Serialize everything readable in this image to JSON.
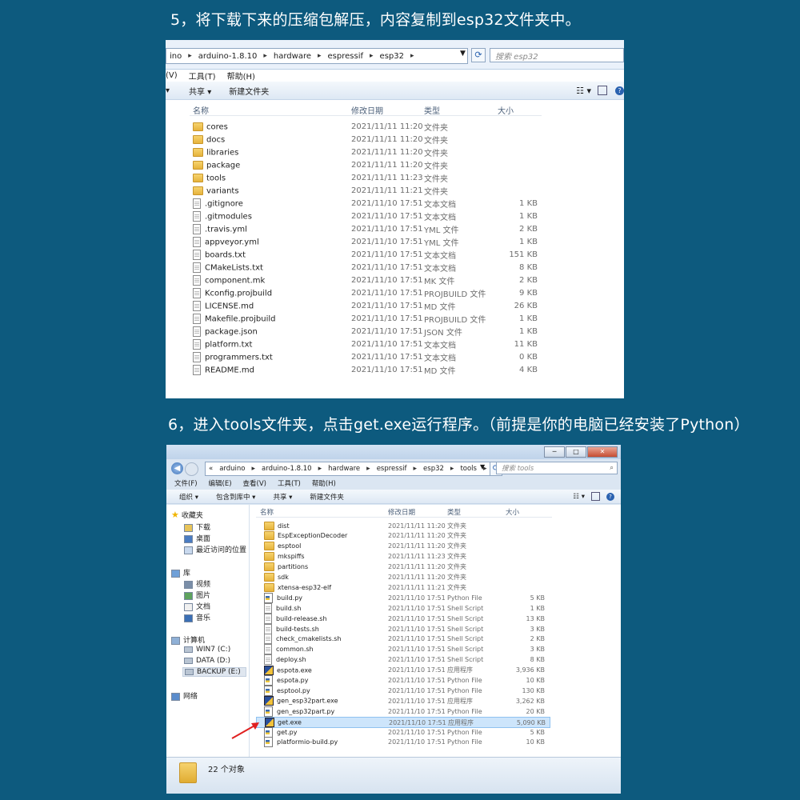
{
  "step5": {
    "heading": "5，将下载下来的压缩包解压，内容复制到esp32文件夹中。",
    "breadcrumb": [
      "ino",
      "arduino-1.8.10",
      "hardware",
      "espressif",
      "esp32"
    ],
    "search_placeholder": "搜索 esp32",
    "menus": [
      "(V)",
      "工具(T)",
      "帮助(H)"
    ],
    "toolbar": [
      "共享 ▾",
      "新建文件夹"
    ],
    "columns": [
      "名称",
      "修改日期",
      "类型",
      "大小"
    ],
    "files": [
      {
        "name": "cores",
        "date": "2021/11/11 11:20",
        "type": "文件夹",
        "size": "",
        "icon": "folder"
      },
      {
        "name": "docs",
        "date": "2021/11/11 11:20",
        "type": "文件夹",
        "size": "",
        "icon": "folder"
      },
      {
        "name": "libraries",
        "date": "2021/11/11 11:20",
        "type": "文件夹",
        "size": "",
        "icon": "folder"
      },
      {
        "name": "package",
        "date": "2021/11/11 11:20",
        "type": "文件夹",
        "size": "",
        "icon": "folder"
      },
      {
        "name": "tools",
        "date": "2021/11/11 11:23",
        "type": "文件夹",
        "size": "",
        "icon": "folder"
      },
      {
        "name": "variants",
        "date": "2021/11/11 11:21",
        "type": "文件夹",
        "size": "",
        "icon": "folder"
      },
      {
        "name": ".gitignore",
        "date": "2021/11/10 17:51",
        "type": "文本文档",
        "size": "1 KB",
        "icon": "file"
      },
      {
        "name": ".gitmodules",
        "date": "2021/11/10 17:51",
        "type": "文本文档",
        "size": "1 KB",
        "icon": "file"
      },
      {
        "name": ".travis.yml",
        "date": "2021/11/10 17:51",
        "type": "YML 文件",
        "size": "2 KB",
        "icon": "file"
      },
      {
        "name": "appveyor.yml",
        "date": "2021/11/10 17:51",
        "type": "YML 文件",
        "size": "1 KB",
        "icon": "file"
      },
      {
        "name": "boards.txt",
        "date": "2021/11/10 17:51",
        "type": "文本文档",
        "size": "151 KB",
        "icon": "file"
      },
      {
        "name": "CMakeLists.txt",
        "date": "2021/11/10 17:51",
        "type": "文本文档",
        "size": "8 KB",
        "icon": "file"
      },
      {
        "name": "component.mk",
        "date": "2021/11/10 17:51",
        "type": "MK 文件",
        "size": "2 KB",
        "icon": "file"
      },
      {
        "name": "Kconfig.projbuild",
        "date": "2021/11/10 17:51",
        "type": "PROJBUILD 文件",
        "size": "9 KB",
        "icon": "file"
      },
      {
        "name": "LICENSE.md",
        "date": "2021/11/10 17:51",
        "type": "MD 文件",
        "size": "26 KB",
        "icon": "file"
      },
      {
        "name": "Makefile.projbuild",
        "date": "2021/11/10 17:51",
        "type": "PROJBUILD 文件",
        "size": "1 KB",
        "icon": "file"
      },
      {
        "name": "package.json",
        "date": "2021/11/10 17:51",
        "type": "JSON 文件",
        "size": "1 KB",
        "icon": "file"
      },
      {
        "name": "platform.txt",
        "date": "2021/11/10 17:51",
        "type": "文本文档",
        "size": "11 KB",
        "icon": "file"
      },
      {
        "name": "programmers.txt",
        "date": "2021/11/10 17:51",
        "type": "文本文档",
        "size": "0 KB",
        "icon": "file"
      },
      {
        "name": "README.md",
        "date": "2021/11/10 17:51",
        "type": "MD 文件",
        "size": "4 KB",
        "icon": "file"
      }
    ]
  },
  "step6": {
    "heading": "6，进入tools文件夹，点击get.exe运行程序。（前提是你的电脑已经安装了Python）",
    "breadcrumb": [
      "«",
      "arduino",
      "arduino-1.8.10",
      "hardware",
      "espressif",
      "esp32",
      "tools"
    ],
    "search_placeholder": "搜索 tools",
    "menus": [
      "文件(F)",
      "编辑(E)",
      "查看(V)",
      "工具(T)",
      "帮助(H)"
    ],
    "toolbar": [
      "组织 ▾",
      "包含到库中 ▾",
      "共享 ▾",
      "新建文件夹"
    ],
    "columns": [
      "名称",
      "修改日期",
      "类型",
      "大小"
    ],
    "nav": [
      {
        "label": "收藏夹",
        "icon": "star-icon"
      },
      {
        "label": "下载",
        "icon": "download-folder-icon"
      },
      {
        "label": "桌面",
        "icon": "desktop-icon"
      },
      {
        "label": "最近访问的位置",
        "icon": "recent-places-icon"
      },
      {
        "label": "库",
        "icon": "library-icon"
      },
      {
        "label": "视频",
        "icon": "video-icon"
      },
      {
        "label": "图片",
        "icon": "picture-icon"
      },
      {
        "label": "文档",
        "icon": "document-icon"
      },
      {
        "label": "音乐",
        "icon": "music-icon"
      },
      {
        "label": "计算机",
        "icon": "computer-icon"
      },
      {
        "label": "WIN7 (C:)",
        "icon": "drive-icon"
      },
      {
        "label": "DATA (D:)",
        "icon": "drive-icon"
      },
      {
        "label": "BACKUP (E:)",
        "icon": "drive-icon"
      },
      {
        "label": "网络",
        "icon": "network-icon"
      }
    ],
    "files": [
      {
        "name": "dist",
        "date": "2021/11/11 11:20",
        "type": "文件夹",
        "size": "",
        "icon": "folder"
      },
      {
        "name": "EspExceptionDecoder",
        "date": "2021/11/11 11:20",
        "type": "文件夹",
        "size": "",
        "icon": "folder"
      },
      {
        "name": "esptool",
        "date": "2021/11/11 11:20",
        "type": "文件夹",
        "size": "",
        "icon": "folder"
      },
      {
        "name": "mkspiffs",
        "date": "2021/11/11 11:23",
        "type": "文件夹",
        "size": "",
        "icon": "folder"
      },
      {
        "name": "partitions",
        "date": "2021/11/11 11:20",
        "type": "文件夹",
        "size": "",
        "icon": "folder"
      },
      {
        "name": "sdk",
        "date": "2021/11/11 11:20",
        "type": "文件夹",
        "size": "",
        "icon": "folder"
      },
      {
        "name": "xtensa-esp32-elf",
        "date": "2021/11/11 11:21",
        "type": "文件夹",
        "size": "",
        "icon": "folder"
      },
      {
        "name": "build.py",
        "date": "2021/11/10 17:51",
        "type": "Python File",
        "size": "5 KB",
        "icon": "py"
      },
      {
        "name": "build.sh",
        "date": "2021/11/10 17:51",
        "type": "Shell Script",
        "size": "1 KB",
        "icon": "file"
      },
      {
        "name": "build-release.sh",
        "date": "2021/11/10 17:51",
        "type": "Shell Script",
        "size": "13 KB",
        "icon": "file"
      },
      {
        "name": "build-tests.sh",
        "date": "2021/11/10 17:51",
        "type": "Shell Script",
        "size": "3 KB",
        "icon": "file"
      },
      {
        "name": "check_cmakelists.sh",
        "date": "2021/11/10 17:51",
        "type": "Shell Script",
        "size": "2 KB",
        "icon": "file"
      },
      {
        "name": "common.sh",
        "date": "2021/11/10 17:51",
        "type": "Shell Script",
        "size": "3 KB",
        "icon": "file"
      },
      {
        "name": "deploy.sh",
        "date": "2021/11/10 17:51",
        "type": "Shell Script",
        "size": "8 KB",
        "icon": "file"
      },
      {
        "name": "espota.exe",
        "date": "2021/11/10 17:51",
        "type": "应用程序",
        "size": "3,936 KB",
        "icon": "exe"
      },
      {
        "name": "espota.py",
        "date": "2021/11/10 17:51",
        "type": "Python File",
        "size": "10 KB",
        "icon": "py"
      },
      {
        "name": "esptool.py",
        "date": "2021/11/10 17:51",
        "type": "Python File",
        "size": "130 KB",
        "icon": "py"
      },
      {
        "name": "gen_esp32part.exe",
        "date": "2021/11/10 17:51",
        "type": "应用程序",
        "size": "3,262 KB",
        "icon": "exe"
      },
      {
        "name": "gen_esp32part.py",
        "date": "2021/11/10 17:51",
        "type": "Python File",
        "size": "20 KB",
        "icon": "py"
      },
      {
        "name": "get.exe",
        "date": "2021/11/10 17:51",
        "type": "应用程序",
        "size": "5,090 KB",
        "icon": "exe",
        "selected": true
      },
      {
        "name": "get.py",
        "date": "2021/11/10 17:51",
        "type": "Python File",
        "size": "5 KB",
        "icon": "py"
      },
      {
        "name": "platformio-build.py",
        "date": "2021/11/10 17:51",
        "type": "Python File",
        "size": "10 KB",
        "icon": "py"
      }
    ],
    "status_text": "22 个对象"
  },
  "colors": {
    "background": "#0d5a7e",
    "selection": "#cde5fb",
    "arrow": "#e02020"
  }
}
